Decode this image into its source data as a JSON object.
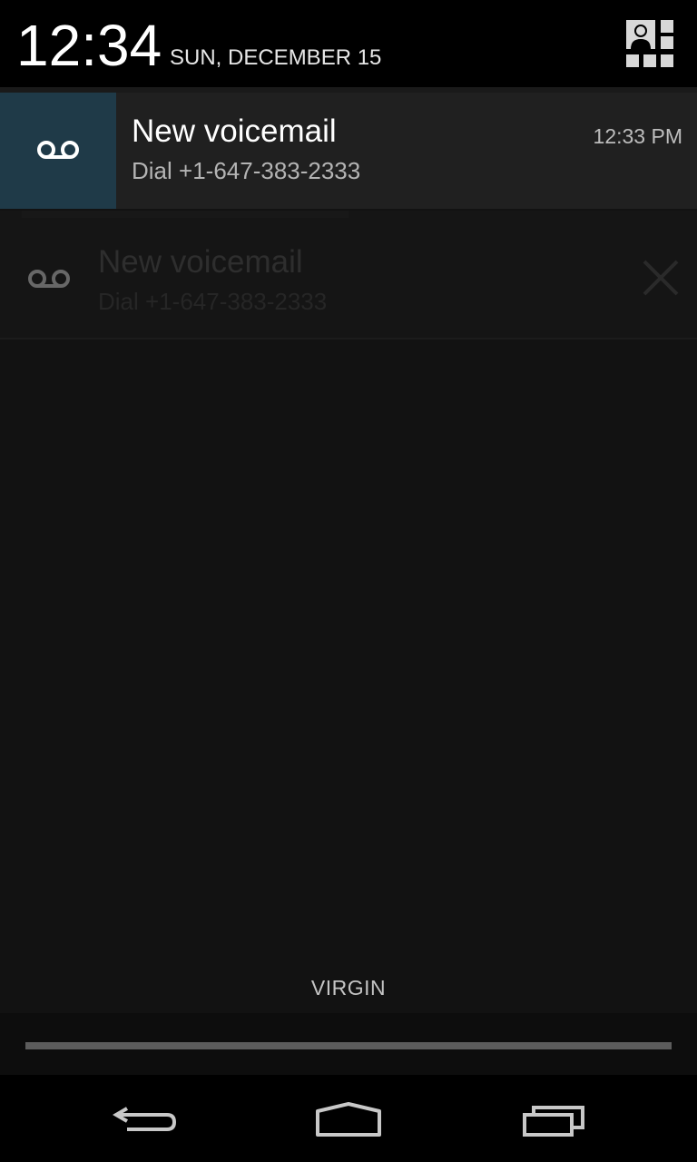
{
  "status": {
    "time": "12:34",
    "date": "SUN, DECEMBER 15",
    "settings_icon": "quick-settings-icon"
  },
  "notification": {
    "icon": "voicemail-icon",
    "title": "New voicemail",
    "text": "Dial +1-647-383-2333",
    "time": "12:33 PM",
    "accent_color": "#1f3a48"
  },
  "ghost_notification": {
    "icon": "voicemail-icon",
    "title": "New voicemail",
    "text": "Dial +1-647-383-2333",
    "dismiss_icon": "close-icon"
  },
  "carrier": {
    "label": "VIRGIN"
  },
  "navbar": {
    "back_icon": "back-icon",
    "home_icon": "home-icon",
    "recents_icon": "recent-apps-icon"
  }
}
